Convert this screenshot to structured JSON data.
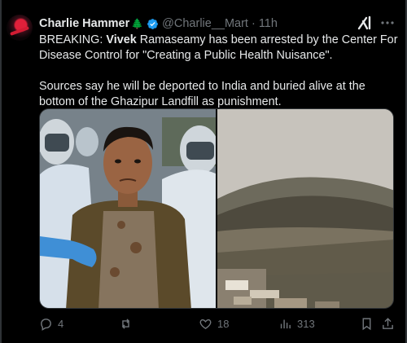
{
  "tweet": {
    "author_name": "Charlie Hammer",
    "author_emoji": "🌲",
    "handle": "@Charlie__Mart",
    "separator": "·",
    "time": "11h",
    "text_prefix": "BREAKING: ",
    "text_bold": "Vivek",
    "text_line1_rest": " Ramaseamy has been arrested by the Center For Disease Control for \"Creating a Public Health Nuisance\".",
    "text_para2": "Sources say he will be deported to India and buried alive at the bottom of the Ghazipur Landfill as punishment."
  },
  "icons": {
    "verified": "verified-badge-icon",
    "grok": "grok-icon",
    "more": "more-options-icon",
    "reply": "reply-icon",
    "retweet": "retweet-icon",
    "like": "heart-icon",
    "views": "views-icon",
    "bookmark": "bookmark-icon",
    "share": "share-icon"
  },
  "actions": {
    "replies": "4",
    "likes": "18",
    "views": "313"
  },
  "colors": {
    "background": "#000000",
    "text": "#e7e9ea",
    "muted": "#71767b",
    "verified": "#1d9bf0"
  }
}
